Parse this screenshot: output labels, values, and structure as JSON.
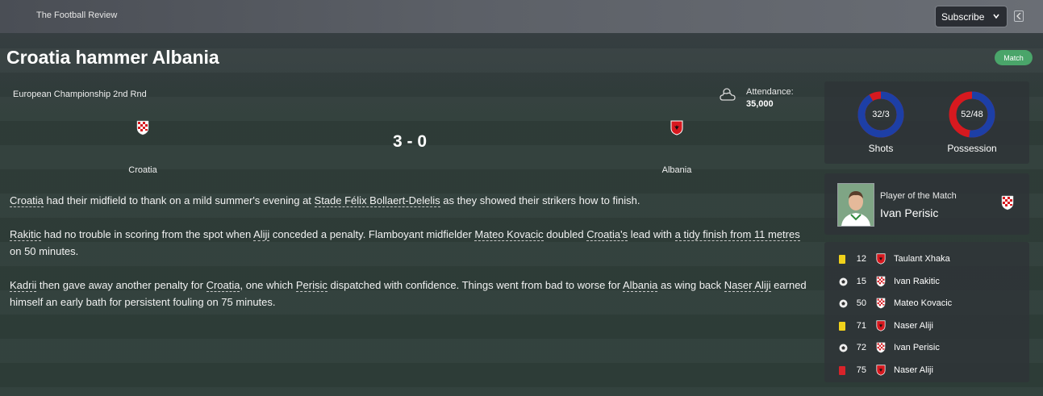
{
  "header": {
    "publication": "The Football Review",
    "subscribe_label": "Subscribe"
  },
  "headline": "Croatia hammer Albania",
  "tag": "Match",
  "match": {
    "competition": "European Championship 2nd Rnd",
    "attendance_label": "Attendance:",
    "attendance_value": "35,000",
    "home_team": "Croatia",
    "away_team": "Albania",
    "score": "3 - 0"
  },
  "article": {
    "p1": [
      {
        "t": "Croatia",
        "link": true
      },
      {
        "t": " had their midfield to thank on a mild summer's evening at "
      },
      {
        "t": "Stade Félix Bollaert-Delelis",
        "link": true
      },
      {
        "t": " as they showed their strikers how to finish."
      }
    ],
    "p2": [
      {
        "t": "Rakitic",
        "link": true
      },
      {
        "t": " had no trouble in scoring from the spot when "
      },
      {
        "t": "Aliji",
        "link": true
      },
      {
        "t": " conceded a penalty. Flamboyant midfielder "
      },
      {
        "t": "Mateo Kovacic",
        "link": true
      },
      {
        "t": " doubled "
      },
      {
        "t": "Croatia's",
        "link": true
      },
      {
        "t": " lead with "
      },
      {
        "t": "a tidy finish from 11 metres",
        "link": true
      },
      {
        "t": " on 50 minutes."
      }
    ],
    "p3": [
      {
        "t": "Kadrii",
        "link": true
      },
      {
        "t": " then gave away another penalty for "
      },
      {
        "t": "Croatia",
        "link": true
      },
      {
        "t": ", one which "
      },
      {
        "t": "Perisic",
        "link": true
      },
      {
        "t": " dispatched with confidence. Things went from bad to worse for "
      },
      {
        "t": "Albania",
        "link": true
      },
      {
        "t": " as wing back "
      },
      {
        "t": "Naser Aliji",
        "link": true
      },
      {
        "t": " earned himself an early bath for persistent fouling on 75 minutes."
      }
    ]
  },
  "stats": {
    "shots": {
      "value": "32/3",
      "label": "Shots",
      "home_share": 0.914
    },
    "possession": {
      "value": "52/48",
      "label": "Possession",
      "home_share": 0.52
    }
  },
  "potm": {
    "label": "Player of the Match",
    "name": "Ivan Perisic"
  },
  "events": [
    {
      "icon": "yellow-card-icon",
      "minute": "12",
      "team": "Albania",
      "player": "Taulant Xhaka"
    },
    {
      "icon": "goal-ball-icon",
      "minute": "15",
      "team": "Croatia",
      "player": "Ivan Rakitic"
    },
    {
      "icon": "goal-ball-icon",
      "minute": "50",
      "team": "Croatia",
      "player": "Mateo Kovacic"
    },
    {
      "icon": "yellow-card-icon",
      "minute": "71",
      "team": "Albania",
      "player": "Naser Aliji"
    },
    {
      "icon": "goal-ball-icon",
      "minute": "72",
      "team": "Croatia",
      "player": "Ivan Perisic"
    },
    {
      "icon": "red-card-icon",
      "minute": "75",
      "team": "Albania",
      "player": "Naser Aliji"
    }
  ],
  "colors": {
    "home": "#1d3fa6",
    "away": "#d7191f",
    "accent": "#4aa56a",
    "yellow_card": "#f1d21b",
    "red_card": "#d9232a"
  }
}
